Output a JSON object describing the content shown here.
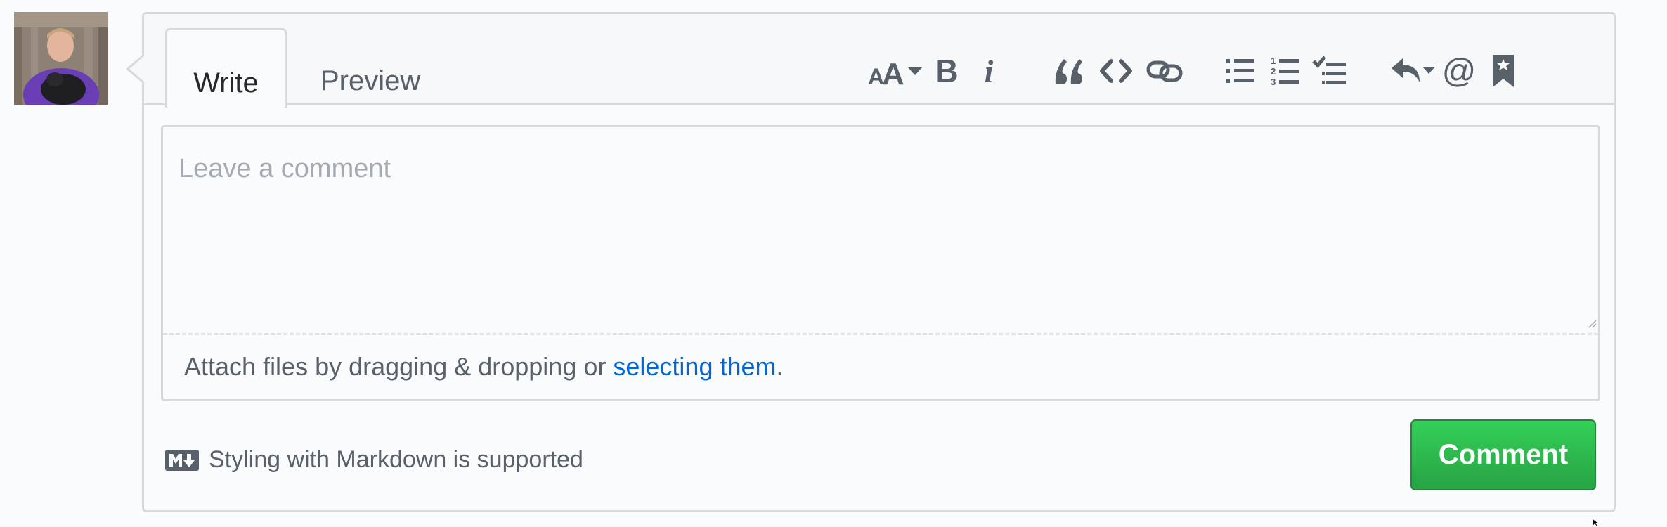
{
  "tabs": [
    {
      "label": "Write",
      "active": true
    },
    {
      "label": "Preview",
      "active": false
    }
  ],
  "toolbar": {
    "icons": [
      "text-size-icon",
      "bold-icon",
      "italic-icon",
      "quote-icon",
      "code-icon",
      "link-icon",
      "bullet-list-icon",
      "numbered-list-icon",
      "task-list-icon",
      "reply-icon",
      "mention-icon",
      "bookmark-icon"
    ],
    "bold_glyph": "B",
    "italic_glyph": "i",
    "mention_glyph": "@"
  },
  "editor": {
    "placeholder": "Leave a comment",
    "attach_text": "Attach files by dragging & dropping or ",
    "attach_link": "selecting them",
    "attach_suffix": "."
  },
  "footer": {
    "markdown_note": "Styling with Markdown is supported",
    "comment_button": "Comment"
  },
  "colors": {
    "accent_link": "#0366d6",
    "button_green": "#28a745",
    "border": "#d6dadf",
    "background": "#fafbfc"
  }
}
